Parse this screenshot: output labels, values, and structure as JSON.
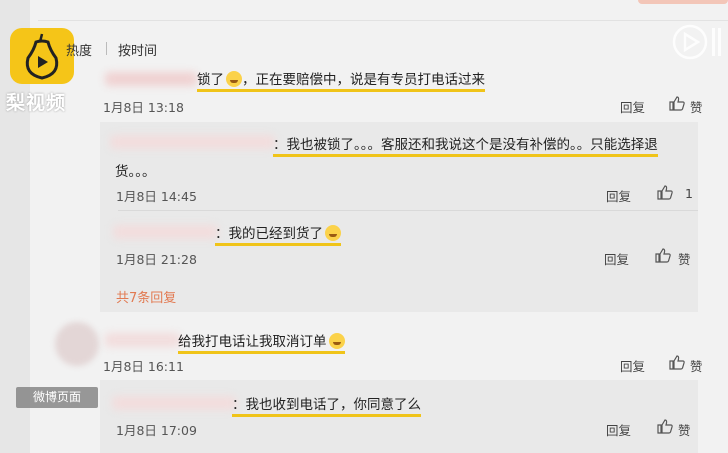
{
  "brand": {
    "name": "梨视频"
  },
  "sort": {
    "hot": "热度",
    "time": "按时间"
  },
  "comments": [
    {
      "text": "锁了",
      "text_rest": "，正在要赔偿中，说是有专员打电话过来",
      "date": "1月8日 13:18",
      "reply": "回复",
      "like": "赞"
    },
    {
      "text": "：我也被锁了。。。客服还和我说这个是没有补偿的。。只能选择退",
      "text2": "货。。。",
      "date": "1月8日 14:45",
      "reply": "回复",
      "like": "1"
    },
    {
      "text": "：我的已经到货了",
      "date": "1月8日 21:28",
      "reply": "回复",
      "like": "赞"
    },
    {
      "more": "共7条回复"
    },
    {
      "text": "给我打电话让我取消订单",
      "date": "1月8日 16:11",
      "reply": "回复",
      "like": "赞"
    },
    {
      "text": "：我也收到电话了，你同意了么",
      "date": "1月8日 17:09",
      "reply": "回复",
      "like": "赞"
    }
  ],
  "page_tag": "微博页面",
  "colors": {
    "highlight": "#f0c419",
    "accent": "#e27a52",
    "logo": "#f5c518"
  },
  "icons": [
    "pear-video-logo-icon",
    "thumbs-up-icon",
    "video-play-icon"
  ]
}
